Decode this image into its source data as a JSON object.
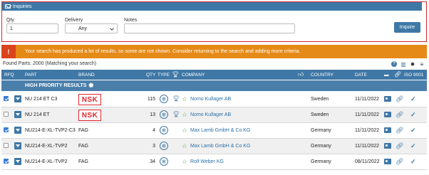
{
  "inquiry": {
    "header": "Inquiries",
    "qty_label": "Qty",
    "qty_value": "1",
    "delivery_label": "Delivery",
    "delivery_value": "Any",
    "notes_label": "Notes",
    "notes_value": "",
    "button": "Inquire"
  },
  "alert": {
    "icon": "!",
    "text": "Your search has produced a lot of results, so some are not shown. Consider returning to the search and adding more criteria."
  },
  "found": "Found Parts: 2000  (Matching your search)",
  "columns": {
    "rfq": "RFQ",
    "part": "PART",
    "brand": "BRAND",
    "qty": "QTY",
    "type": "TYPE",
    "company": "COMPANY",
    "country": "COUNTRY",
    "date": "DATE",
    "iso": "ISO 9001"
  },
  "section": "HIGH PRIORITY RESULTS",
  "rows": [
    {
      "checked": true,
      "part": "NU 214 ET C3",
      "brand": "NSK",
      "qty": "115",
      "company": "Nomo Kullager AB",
      "country": "Sweden",
      "date": "11/11/2022"
    },
    {
      "checked": false,
      "part": "NU 214 ET",
      "brand": "NSK",
      "qty": "13",
      "company": "Nomo Kullager AB",
      "country": "Sweden",
      "date": "11/11/2022"
    },
    {
      "checked": true,
      "part": "NU214-E-XL-TVP2-C3",
      "brand": "FAG",
      "qty": "4",
      "company": "Max Lamb GmbH & Co KG",
      "country": "Germany",
      "date": "11/11/2022"
    },
    {
      "checked": false,
      "part": "NU214-E-XL-TVP2",
      "brand": "FAG",
      "qty": "3",
      "company": "Max Lamb GmbH & Co KG",
      "country": "Germany",
      "date": "11/11/2022"
    },
    {
      "checked": true,
      "part": "NU214-E-XL-TVP2",
      "brand": "FAG",
      "qty": "34",
      "company": "Rolf Weber KG",
      "country": "Germany",
      "date": "08/11/2022"
    }
  ]
}
